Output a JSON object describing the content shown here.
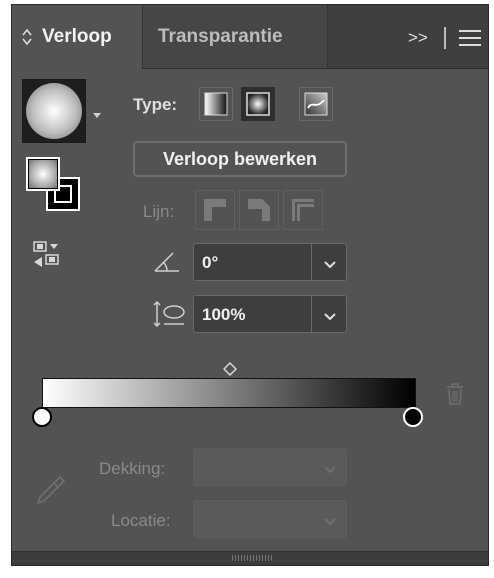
{
  "tabs": {
    "active_label": "Verloop",
    "inactive_label": "Transparantie",
    "overflow_label": ">>"
  },
  "type_row": {
    "label": "Type:",
    "options": [
      "linear-gradient-icon",
      "radial-gradient-icon",
      "freeform-gradient-icon"
    ],
    "selected": "radial-gradient-icon"
  },
  "edit_button": {
    "label": "Verloop bewerken"
  },
  "stroke_row": {
    "label": "Lijn:"
  },
  "angle": {
    "value": "0°"
  },
  "aspect_ratio": {
    "value": "100%"
  },
  "gradient": {
    "start_color": "#ffffff",
    "end_color": "#000000"
  },
  "opacity": {
    "label": "Dekking:",
    "value": ""
  },
  "location": {
    "label": "Locatie:",
    "value": ""
  }
}
